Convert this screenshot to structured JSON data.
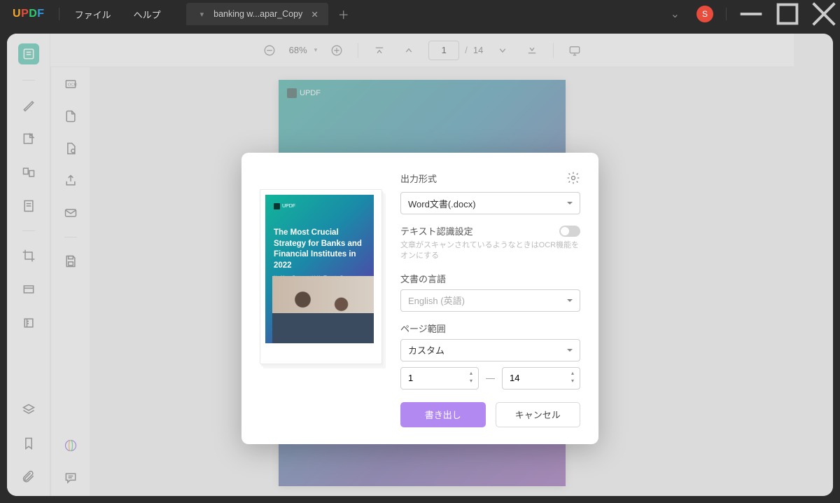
{
  "titlebar": {
    "logo": "UPDF",
    "menu": {
      "file": "ファイル",
      "help": "ヘルプ"
    },
    "tab": {
      "title": "banking w...apar_Copy"
    },
    "avatar_letter": "S"
  },
  "toolbar": {
    "zoom": "68%",
    "page_current": "1",
    "page_sep": "/",
    "page_total": "14"
  },
  "document": {
    "brand": "UPDF"
  },
  "modal": {
    "output_format_label": "出力形式",
    "output_format_value": "Word文書(.docx)",
    "ocr_label": "テキスト認識設定",
    "ocr_hint": "文章がスキャンされているようなときはOCR機能をオンにする",
    "lang_label": "文書の言語",
    "lang_value": "English (英語)",
    "range_label": "ページ範囲",
    "range_value": "カスタム",
    "range_from": "1",
    "range_to": "14",
    "export_btn": "書き出し",
    "cancel_btn": "キャンセル",
    "preview": {
      "brand": "UPDF",
      "title": "The Most Crucial Strategy for Banks and Financial Institutes in 2022",
      "subtitle": "No More Paperwork! It's Time to Go Paperless"
    }
  }
}
